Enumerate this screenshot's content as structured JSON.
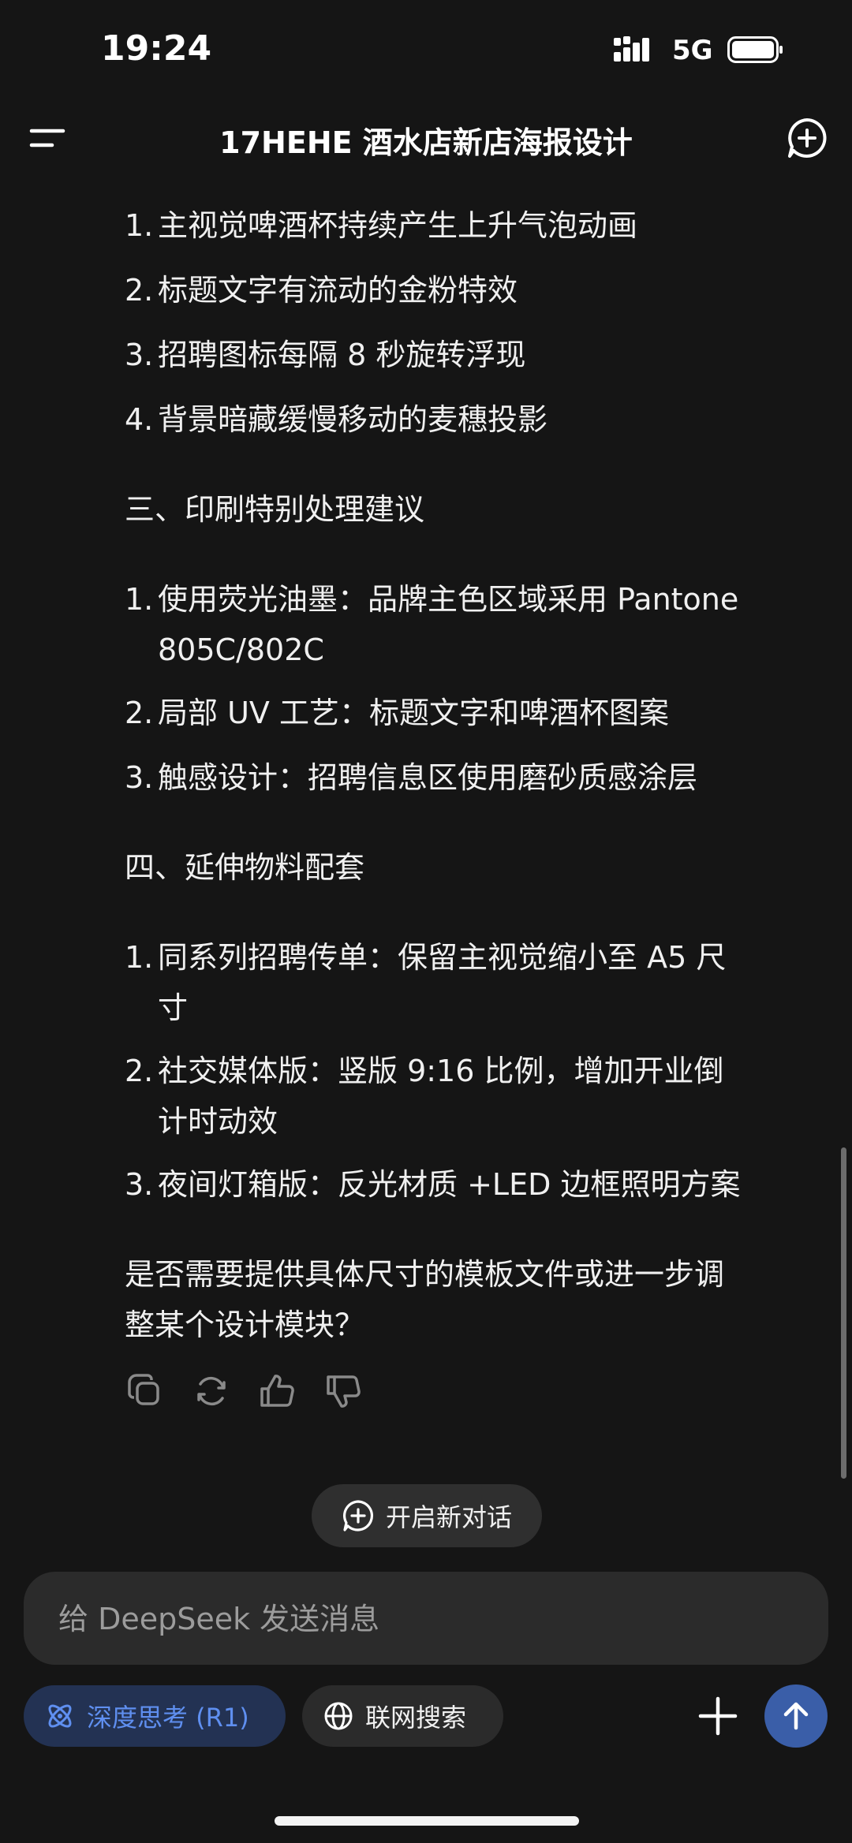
{
  "status": {
    "time": "19:24",
    "network": "5G"
  },
  "header": {
    "title": "17HEHE 酒水店新店海报设计"
  },
  "messages": [
    {
      "num": "1.",
      "text": "主视觉啤酒杯持续产生上升气泡动画"
    },
    {
      "num": "2.",
      "text": "标题文字有流动的金粉特效"
    },
    {
      "num": "3.",
      "text": "招聘图标每隔 8 秒旋转浮现"
    },
    {
      "num": "4.",
      "text": "背景暗藏缓慢移动的麦穗投影"
    },
    {
      "heading": "三、印刷特别处理建议"
    },
    {
      "num": "1.",
      "text": "使用荧光油墨：品牌主色区域采用 Pantone"
    },
    {
      "cont": "805C/802C"
    },
    {
      "num": "2.",
      "text": "局部 UV 工艺：标题文字和啤酒杯图案"
    },
    {
      "num": "3.",
      "text": "触感设计：招聘信息区使用磨砂质感涂层"
    },
    {
      "heading": "四、延伸物料配套"
    },
    {
      "num": "1.",
      "text": "同系列招聘传单：保留主视觉缩小至 A5 尺"
    },
    {
      "cont": "寸"
    },
    {
      "num": "2.",
      "text": "社交媒体版：竖版 9:16 比例，增加开业倒"
    },
    {
      "cont": "计时动效"
    },
    {
      "num": "3.",
      "text": "夜间灯箱版：反光材质 +LED 边框照明方案"
    },
    {
      "para": "是否需要提供具体尺寸的模板文件或进一步调"
    },
    {
      "para": "整某个设计模块？"
    }
  ],
  "actions": {
    "icons": [
      "copy-icon",
      "regenerate-icon",
      "thumbs-up-icon",
      "thumbs-down-icon"
    ]
  },
  "new_chat": {
    "label": "开启新对话"
  },
  "input": {
    "placeholder": "给 DeepSeek 发送消息"
  },
  "chips": {
    "deep_think": "深度思考 (R1)",
    "web_search": "联网搜索"
  },
  "colors": {
    "background": "#151515",
    "accent": "#3a5ea8",
    "chip_active_text": "#5f8ff0"
  }
}
